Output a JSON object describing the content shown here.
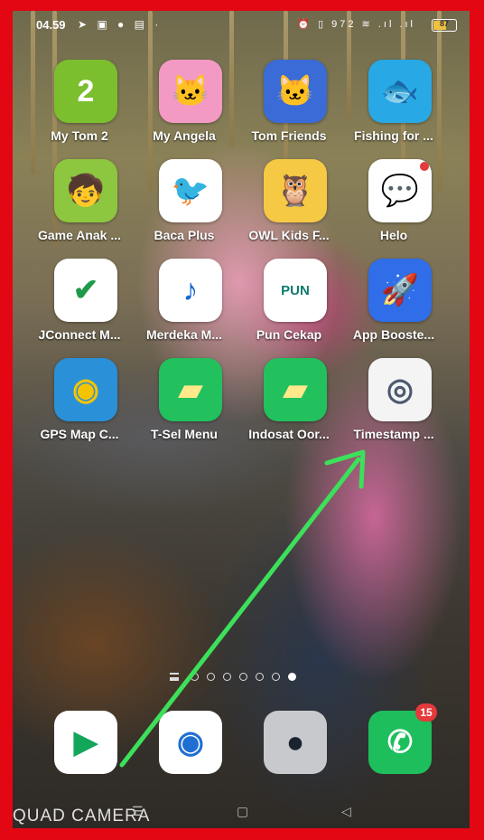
{
  "status_bar": {
    "time": "04.59",
    "left_icons": "➤ ▣ ● ▤ ·",
    "right_icons": "⏰ ▯ 972 ≋ .ıl .ıl",
    "battery_level": 0.55,
    "battery_label": "87"
  },
  "apps": [
    {
      "label": "My Tom 2",
      "icon": "talking-tom-2-icon",
      "bg": "#7bbf2e",
      "glyph": "2",
      "color": "#ffffff"
    },
    {
      "label": "My Angela",
      "icon": "talking-angela-icon",
      "bg": "#f39ac4",
      "glyph": "🐱",
      "color": "#ffffff"
    },
    {
      "label": "Tom Friends",
      "icon": "tom-friends-icon",
      "bg": "#3b6bd6",
      "glyph": "🐱",
      "color": "#ffffff"
    },
    {
      "label": "Fishing for ...",
      "icon": "fishing-game-icon",
      "bg": "#29a8e6",
      "glyph": "🐟",
      "color": "#ffffff"
    },
    {
      "label": "Game Anak ...",
      "icon": "game-anak-icon",
      "bg": "#8dc63f",
      "glyph": "🧒",
      "color": "#ffffff"
    },
    {
      "label": "Baca Plus",
      "icon": "baca-plus-icon",
      "bg": "#ffffff",
      "glyph": "🐦",
      "color": "#d62b2b"
    },
    {
      "label": "OWL Kids F...",
      "icon": "owl-kids-icon",
      "bg": "#f6c945",
      "glyph": "🦉",
      "color": "#ffffff"
    },
    {
      "label": "Helo",
      "icon": "helo-icon",
      "bg": "#ffffff",
      "glyph": "💬",
      "color": "#f15a2b"
    },
    {
      "label": "JConnect M...",
      "icon": "jconnect-icon",
      "bg": "#ffffff",
      "glyph": "✔",
      "color": "#1f9a4a"
    },
    {
      "label": "Merdeka M...",
      "icon": "merdeka-mengajar-icon",
      "bg": "#ffffff",
      "glyph": "♪",
      "color": "#1768d2"
    },
    {
      "label": "Pun Cekap",
      "icon": "pun-cekap-icon",
      "bg": "#ffffff",
      "glyph": "PUN",
      "color": "#0d7a6d"
    },
    {
      "label": "App Booste...",
      "icon": "rocket-icon",
      "bg": "#2f6ee8",
      "glyph": "🚀",
      "color": "#ffffff"
    },
    {
      "label": "GPS Map C...",
      "icon": "gps-camera-icon",
      "bg": "#2a90d8",
      "glyph": "◉",
      "color": "#f5c400"
    },
    {
      "label": "T-Sel Menu",
      "icon": "sim-card-icon",
      "bg": "#22c15e",
      "glyph": "▰",
      "color": "#ffe98a"
    },
    {
      "label": "Indosat Oor...",
      "icon": "sim-card-icon",
      "bg": "#22c15e",
      "glyph": "▰",
      "color": "#ffe98a"
    },
    {
      "label": "Timestamp ...",
      "icon": "camera-lens-icon",
      "bg": "#f4f4f4",
      "glyph": "◎",
      "color": "#4a5a6e"
    }
  ],
  "page_indicator": {
    "page_count": 7,
    "active_page": 7
  },
  "dock": [
    {
      "name": "play-store-icon",
      "bg": "#ffffff",
      "glyph": "▶",
      "color": "#13a55a"
    },
    {
      "name": "camera-icon",
      "bg": "#ffffff",
      "glyph": "◉",
      "color": "#1f6fd2"
    },
    {
      "name": "camera-icon",
      "bg": "#c7c9cd",
      "glyph": "●",
      "color": "#1b2230"
    },
    {
      "name": "whatsapp-icon",
      "bg": "#1ebe5d",
      "glyph": "✆",
      "color": "#ffffff",
      "badge": "15"
    }
  ],
  "watermark": "QUAD CAMERA",
  "colors": {
    "frame": "#e30613",
    "arrow": "#3ce05a"
  }
}
